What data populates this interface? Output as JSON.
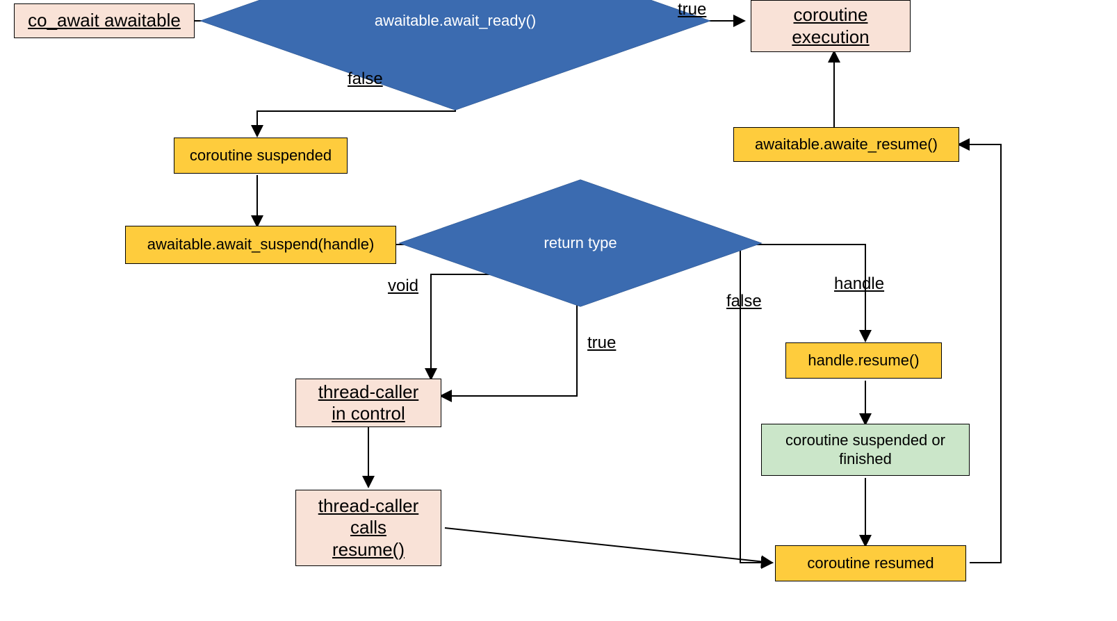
{
  "nodes": {
    "coawait": "co_await awaitable",
    "await_ready": "awaitable.await_ready()",
    "coroutine_exec_l1": "coroutine",
    "coroutine_exec_l2": "execution",
    "await_resume": "awaitable.awaite_resume()",
    "suspended": "coroutine suspended",
    "await_suspend": "awaitable.await_suspend(handle)",
    "return_type": "return type",
    "thread_caller_l1": "thread-caller",
    "thread_caller_l2": "in control",
    "thread_calls_l1": "thread-caller",
    "thread_calls_l2": "calls",
    "thread_calls_l3": "resume()",
    "handle_resume": "handle.resume()",
    "suspended_or_finished_l1": "coroutine suspended or",
    "suspended_or_finished_l2": "finished",
    "resumed": "coroutine resumed"
  },
  "edge_labels": {
    "true_top": "true",
    "false_top": "false",
    "void": "void",
    "true_mid": "true",
    "false_right": "false",
    "handle": "handle"
  }
}
